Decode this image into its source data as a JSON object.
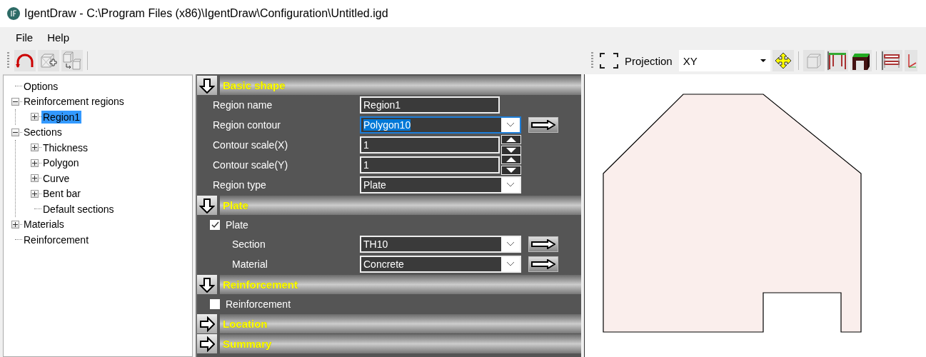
{
  "window": {
    "title": "IgentDraw - C:\\Program Files (x86)\\IgentDraw\\Configuration\\Untitled.igd"
  },
  "menu": [
    "File",
    "Help"
  ],
  "tree": [
    {
      "label": "Options",
      "selected": false
    },
    {
      "label": "Reinforcement regions",
      "selected": false,
      "expanded": true,
      "children": [
        {
          "label": "Region1",
          "selected": true,
          "expanded": false
        }
      ]
    },
    {
      "label": "Sections",
      "selected": false,
      "expanded": true,
      "children": [
        {
          "label": "Thickness",
          "selected": false,
          "expanded": false
        },
        {
          "label": "Polygon",
          "selected": false,
          "expanded": false
        },
        {
          "label": "Curve",
          "selected": false,
          "expanded": false
        },
        {
          "label": "Bent bar",
          "selected": false,
          "expanded": false
        },
        {
          "label": "Default sections",
          "selected": false
        }
      ]
    },
    {
      "label": "Materials",
      "selected": false,
      "expanded": false
    },
    {
      "label": "Reinforcement",
      "selected": false
    }
  ],
  "view_toolbar": {
    "label": "Projection",
    "projection": "XY"
  },
  "sections": [
    {
      "title": "Basic shape",
      "expanded": true,
      "rows": [
        {
          "kind": "text",
          "label": "Region name",
          "value": "Region1",
          "focused": false,
          "link_button": false
        },
        {
          "kind": "combo",
          "label": "Region contour",
          "value": "Polygon10",
          "focused": true,
          "link_button": true
        },
        {
          "kind": "spin",
          "label": "Contour scale(X)",
          "value": "1",
          "focused": false,
          "link_button": false
        },
        {
          "kind": "spin",
          "label": "Contour scale(Y)",
          "value": "1",
          "focused": false,
          "link_button": false
        },
        {
          "kind": "combo",
          "label": "Region type",
          "value": "Plate",
          "focused": false,
          "link_button": false
        }
      ]
    },
    {
      "title": "Plate",
      "expanded": true,
      "rows": [
        {
          "kind": "checkbox",
          "label": "Plate",
          "checked": true,
          "children": [
            {
              "kind": "combo",
              "label": "Section",
              "value": "TH10",
              "focused": false,
              "link_button": true
            },
            {
              "kind": "combo",
              "label": "Material",
              "value": "Concrete",
              "focused": false,
              "link_button": true
            }
          ]
        }
      ]
    },
    {
      "title": "Reinforcement",
      "expanded": true,
      "rows": [
        {
          "kind": "checkbox",
          "label": "Reinforcement",
          "checked": false
        }
      ]
    },
    {
      "title": "Location",
      "expanded": false
    },
    {
      "title": "Summary",
      "expanded": false
    }
  ]
}
